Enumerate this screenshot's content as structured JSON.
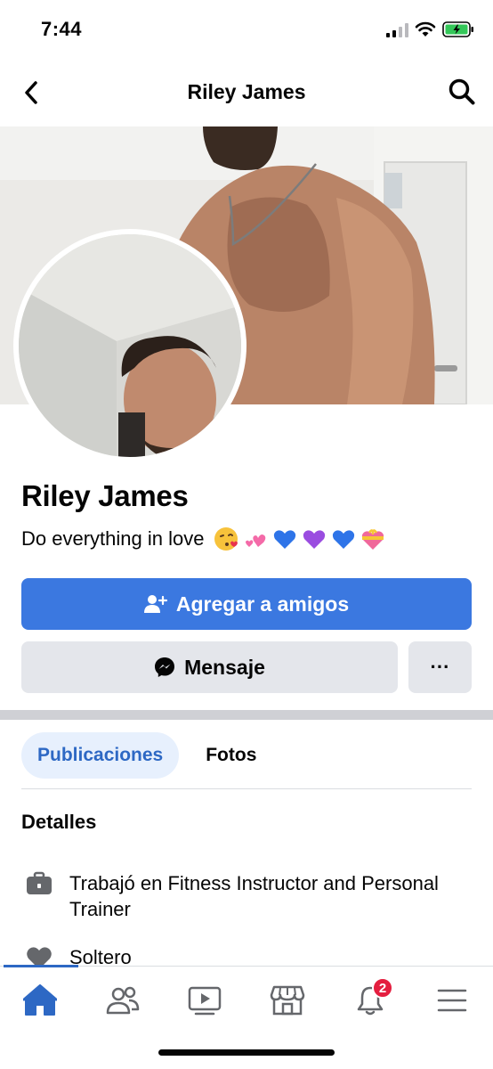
{
  "status_bar": {
    "time": "7:44"
  },
  "nav": {
    "title": "Riley James"
  },
  "profile": {
    "name": "Riley James",
    "bio": "Do everything in love",
    "bio_emojis": [
      "kissing-face-emoji",
      "two-hearts-emoji",
      "blue-heart-emoji",
      "purple-heart-emoji",
      "blue-heart-emoji",
      "heart-with-ribbon-emoji"
    ]
  },
  "actions": {
    "add_friend_label": "Agregar a amigos",
    "message_label": "Mensaje",
    "more_label": "···"
  },
  "tabs": [
    {
      "label": "Publicaciones",
      "active": true
    },
    {
      "label": "Fotos",
      "active": false
    }
  ],
  "details": {
    "heading": "Detalles",
    "items": [
      {
        "icon": "briefcase-icon",
        "text": "Trabajó en Fitness Instructor and Personal Trainer"
      },
      {
        "icon": "heart-icon",
        "text": "Soltero"
      }
    ]
  },
  "tabbar": {
    "items": [
      {
        "icon": "home-icon",
        "active": true
      },
      {
        "icon": "friends-icon",
        "active": false
      },
      {
        "icon": "watch-icon",
        "active": false
      },
      {
        "icon": "marketplace-icon",
        "active": false
      },
      {
        "icon": "notifications-icon",
        "active": false,
        "badge": "2"
      },
      {
        "icon": "menu-icon",
        "active": false
      }
    ]
  },
  "colors": {
    "accent": "#3b78e0",
    "tab_active_bg": "#e7f0fd",
    "tab_active_text": "#2d68c4",
    "badge": "#e41e3f",
    "button_grey": "#e4e6eb"
  }
}
